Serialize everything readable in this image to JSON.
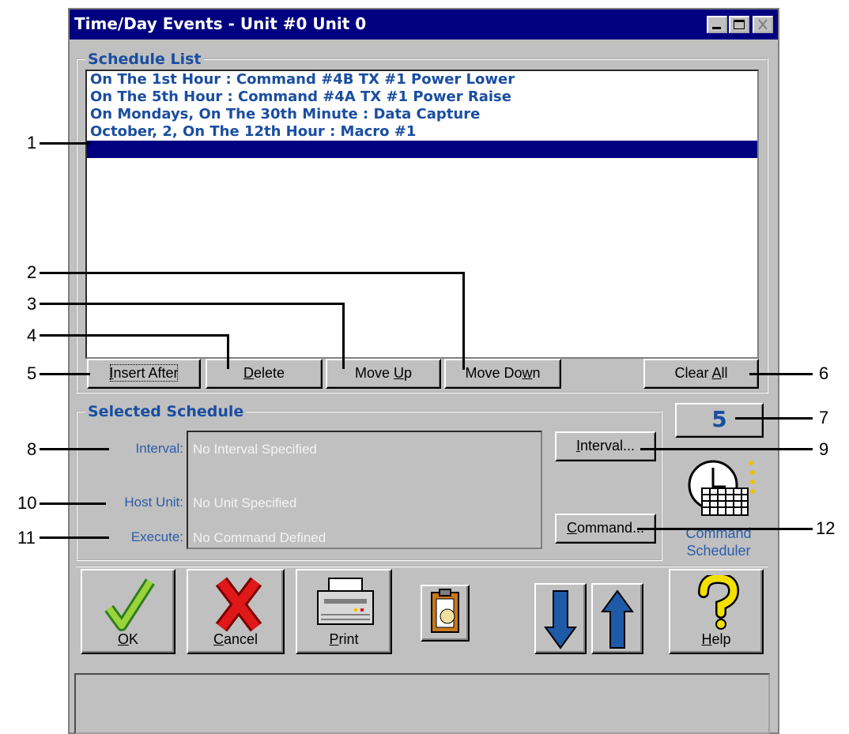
{
  "window": {
    "title": "Time/Day Events - Unit #0 Unit 0"
  },
  "schedule_list": {
    "label": "Schedule List",
    "items": [
      "On The 1st Hour : Command #4B TX #1 Power Lower",
      "On The 5th Hour : Command #4A TX #1 Power Raise",
      "On Mondays, On The 30th Minute : Data Capture",
      "October, 2, On The 12th Hour : Macro #1",
      ""
    ],
    "selected_index": 4
  },
  "list_buttons": {
    "insert_after": {
      "pre": "",
      "key": "I",
      "post": "nsert After"
    },
    "delete": {
      "pre": "",
      "key": "D",
      "post": "elete"
    },
    "move_up": {
      "pre": "Move ",
      "key": "U",
      "post": "p"
    },
    "move_down": {
      "pre": "Move Do",
      "key": "w",
      "post": "n"
    },
    "clear_all": {
      "pre": "Clear ",
      "key": "A",
      "post": "ll"
    }
  },
  "selected_schedule": {
    "label": "Selected Schedule",
    "interval_label": "Interval:",
    "host_label": "Host Unit:",
    "execute_label": "Execute:",
    "interval_value": "No Interval Specified",
    "host_value": "No Unit Specified",
    "execute_value": "No Command Defined",
    "interval_button": {
      "pre": "",
      "key": "I",
      "post": "nterval..."
    },
    "command_button": {
      "pre": "",
      "key": "C",
      "post": "ommand..."
    }
  },
  "count": "5",
  "scheduler_icon_label": {
    "line1": "Command",
    "line2": "Scheduler"
  },
  "bottom_buttons": {
    "ok": {
      "pre": "",
      "key": "O",
      "post": "K"
    },
    "cancel": {
      "pre": "",
      "key": "C",
      "post": "ancel"
    },
    "print": {
      "pre": "",
      "key": "P",
      "post": "rint"
    },
    "help": {
      "pre": "",
      "key": "H",
      "post": "elp"
    }
  },
  "callouts": [
    "1",
    "2",
    "3",
    "4",
    "5",
    "6",
    "7",
    "8",
    "9",
    "10",
    "11",
    "12"
  ],
  "colors": {
    "title_bar": "#000080",
    "label_blue": "#1a4ea0",
    "face": "#c0c0c0",
    "selection": "#000080"
  }
}
